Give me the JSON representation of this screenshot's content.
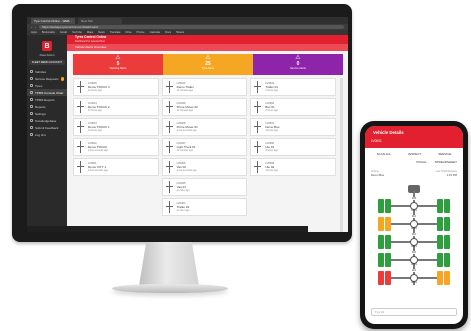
{
  "desktop": {
    "browser": {
      "tabs": [
        "Tyre Control Online - WEB...",
        "New Tab"
      ],
      "url": "https://webapp.tyrecontrol.com/dashboard",
      "bookmarks": [
        "Apps",
        "Bookmarks",
        "Gmail",
        "YouTube",
        "Maps",
        "News",
        "Translate",
        "Drive",
        "Photos",
        "Calendar",
        "Docs",
        "Sheets"
      ]
    },
    "sidebar": {
      "logo": "B",
      "user_name": "Fleet Admin",
      "account": "FLEET DEMO ACCOUNT",
      "items": [
        {
          "label": "Vehicles",
          "icon": "truck-icon"
        },
        {
          "label": "Service Requests",
          "icon": "wrench-icon",
          "badge": true
        },
        {
          "label": "Tyres",
          "icon": "tyre-icon"
        },
        {
          "label": "TPMS Console Chart",
          "icon": "chart-icon",
          "active": true
        },
        {
          "label": "TPMS Reports",
          "icon": "report-icon"
        },
        {
          "label": "Reports",
          "icon": "document-icon"
        },
        {
          "label": "Settings",
          "icon": "gear-icon"
        },
        {
          "label": "Knowledgebase",
          "icon": "book-icon"
        },
        {
          "label": "Submit Feedback",
          "icon": "feedback-icon"
        },
        {
          "label": "Log Out",
          "icon": "logout-icon"
        }
      ]
    },
    "topbar": {
      "title": "Tyres Control Online",
      "subtitle": "Dashboard for selected fleet"
    },
    "subbar": {
      "label": "Vehicle Alerts Overview"
    },
    "cards": [
      {
        "count": "5",
        "label": "Warning Alerts",
        "color": "#ec3b3b",
        "icon": "warning-icon"
      },
      {
        "count": "25",
        "label": "Tyre Alerts",
        "color": "#f5a623",
        "icon": "warning-icon"
      },
      {
        "count": "0",
        "label": "Service Alerts",
        "color": "#8e24aa",
        "icon": "warning-icon"
      }
    ],
    "columns": [
      [
        {
          "fleet": "LV0015",
          "name": "Demo TRUCK 3",
          "time": "12 hours ago"
        },
        {
          "fleet": "LV0014",
          "name": "Demo TRUCK 2",
          "time": "12 hours ago"
        },
        {
          "fleet": "LV0013",
          "name": "Demo TRUCK 1",
          "time": "13 hours ago"
        },
        {
          "fleet": "LV0012",
          "name": "Demo TRUCK",
          "time": "a few seconds ago"
        },
        {
          "fleet": "LV0011",
          "name": "Demo CITY 1",
          "time": "a few seconds ago"
        }
      ],
      [
        {
          "fleet": "LV0010",
          "name": "Demo Trailer",
          "time": "12 minutes ago"
        },
        {
          "fleet": "LV0009",
          "name": "Prime Mover 02",
          "time": "12 minutes ago"
        },
        {
          "fleet": "LV0008",
          "name": "Prime Mover 01",
          "time": "a few seconds ago"
        },
        {
          "fleet": "LV0007",
          "name": "Light Truck 01",
          "time": "12 minutes ago"
        },
        {
          "fleet": "LV0006",
          "name": "Van 02",
          "time": "a few seconds ago"
        },
        {
          "fleet": "LV0005",
          "name": "Van 01",
          "time": "an hour ago"
        },
        {
          "fleet": "LV0004",
          "name": "Trailer 02",
          "time": "an hour ago"
        }
      ],
      [
        {
          "fleet": "LV0003",
          "name": "Trailer 01",
          "time": "2 hours ago"
        },
        {
          "fleet": "LV0002",
          "name": "Bus 01",
          "time": "2 hours ago"
        },
        {
          "fleet": "LV0001",
          "name": "Demo Bus",
          "time": "3 hours ago"
        },
        {
          "fleet": "LV0000",
          "name": "Ute 01",
          "time": "3 hours ago"
        },
        {
          "fleet": "LV0099",
          "name": "Ute 02",
          "time": "4 hours ago"
        }
      ]
    ]
  },
  "phone": {
    "title": "Vehicle Details",
    "subtitle": "LV0001",
    "actions": [
      "SCAN ALL",
      "INSPECT",
      "SERVICE"
    ],
    "toggles": [
      "VISUAL",
      "SPREADSHEET"
    ],
    "info": {
      "left_label": "Vehicle",
      "left_value": "Demo Bus",
      "right_label": "Last TPMS Reading",
      "right_value": "1:15 PM"
    },
    "axles": [
      {
        "top": "100",
        "bottom": "1/1/1",
        "left_color": "#2e9e3f",
        "right_color": "#2e9e3f"
      },
      {
        "top": "110",
        "bottom": "0/1/1",
        "left_color": "#f5a623",
        "right_color": "#2e9e3f"
      },
      {
        "top": "110",
        "bottom": "0/1/1",
        "left_color": "#2e9e3f",
        "right_color": "#2e9e3f"
      },
      {
        "top": "110",
        "bottom": "0/1/1",
        "left_color": "#2e9e3f",
        "right_color": "#2e9e3f"
      },
      {
        "top": "110",
        "bottom": "0/1/1",
        "left_color": "#ec3b3b",
        "right_color": "#f5a623"
      }
    ],
    "footer_placeholder": "Tyre 1/4"
  }
}
